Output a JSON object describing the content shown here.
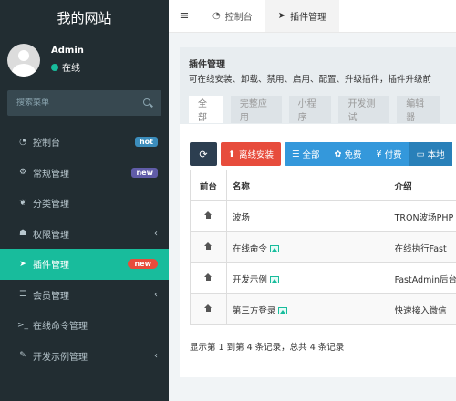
{
  "brand": "我的网站",
  "user": {
    "name": "Admin",
    "status": "在线"
  },
  "search": {
    "placeholder": "搜索菜单"
  },
  "menu": [
    {
      "label": "控制台",
      "icon": "dashboard-icon",
      "badge": "hot"
    },
    {
      "label": "常规管理",
      "icon": "cogs-icon",
      "badge": "new"
    },
    {
      "label": "分类管理",
      "icon": "leaf-icon"
    },
    {
      "label": "权限管理",
      "icon": "group-icon",
      "chevron": "‹"
    },
    {
      "label": "插件管理",
      "icon": "rocket-icon",
      "badge": "new"
    },
    {
      "label": "会员管理",
      "icon": "list-icon",
      "chevron": "‹"
    },
    {
      "label": "在线命令管理",
      "icon": "terminal-icon"
    },
    {
      "label": "开发示例管理",
      "icon": "magic-icon",
      "chevron": "‹"
    }
  ],
  "topbar": {
    "tabs": [
      {
        "label": "控制台",
        "icon": "dashboard-icon"
      },
      {
        "label": "插件管理",
        "icon": "rocket-icon"
      }
    ]
  },
  "panel": {
    "title": "插件管理",
    "description": "可在线安装、卸载、禁用、启用、配置、升级插件，插件升级前",
    "filter_tabs": [
      "全部",
      "完整应用",
      "小程序",
      "开发测试",
      "编辑器"
    ],
    "toolbar": {
      "offline_install": "离线安装",
      "all": "全部",
      "free": "免费",
      "paid": "付费",
      "local": "本地"
    }
  },
  "table": {
    "headers": [
      "前台",
      "名称",
      "介绍"
    ],
    "rows": [
      {
        "name": "波场",
        "intro": "TRON波场PHP",
        "has_image": false
      },
      {
        "name": "在线命令",
        "intro": "在线执行Fast",
        "has_image": true
      },
      {
        "name": "开发示例",
        "intro": "FastAdmin后台",
        "has_image": true
      },
      {
        "name": "第三方登录",
        "intro": "快速接入微信",
        "has_image": true
      }
    ]
  },
  "footer": {
    "summary": "显示第 1 到第 4 条记录，总共 4 条记录"
  },
  "colors": {
    "sidebar": "#222d32",
    "accent": "#18bc9c",
    "danger": "#e74c3c",
    "primary": "#3498db",
    "dark": "#2c3e50"
  }
}
